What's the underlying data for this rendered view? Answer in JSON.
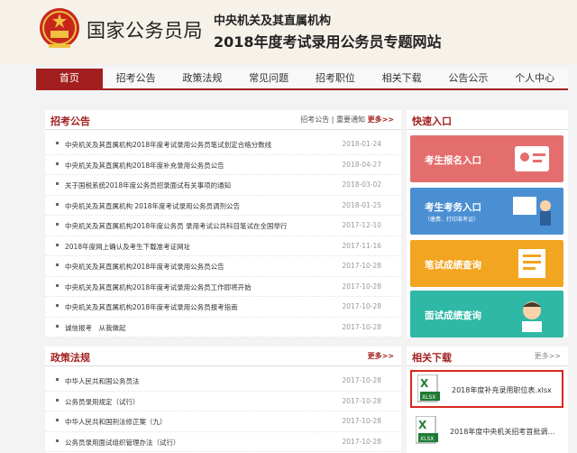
{
  "header": {
    "brand": "国家公务员局",
    "line1": "中央机关及其直属机构",
    "line2": "2018年度考试录用公务员专题网站"
  },
  "nav": [
    "首页",
    "招考公告",
    "政策法规",
    "常见问题",
    "招考职位",
    "相关下载",
    "公告公示",
    "个人中心"
  ],
  "announcements": {
    "title": "招考公告",
    "more_a": "招考公告",
    "more_sep": " | ",
    "more_b": "重要通知",
    "more_c": "更多>>",
    "items": [
      {
        "title": "中央机关及其直属机构2018年度考试录用公务员笔试划定合格分数线",
        "date": "2018-01-24"
      },
      {
        "title": "中央机关及其直属机构2018年度补充录用公务员公告",
        "date": "2018-04-27"
      },
      {
        "title": "关于国税系统2018年度公务员招录面试有关事项的通知",
        "date": "2018-03-02"
      },
      {
        "title": "中央机关及其直属机构 2018年度考试录用公务员调剂公告",
        "date": "2018-01-25"
      },
      {
        "title": "中央机关及其直属机构2018年度公务员 录用考试公共科目笔试在全国举行",
        "date": "2017-12-10"
      },
      {
        "title": "2018年度网上确认及考生下载准考证网址",
        "date": "2017-11-16"
      },
      {
        "title": "中央机关及其直属机构2018年度考试录用公务员公告",
        "date": "2017-10-28"
      },
      {
        "title": "中央机关及其直属机构2018年度考试录用公务员工作即将开始",
        "date": "2017-10-28"
      },
      {
        "title": "中央机关及其直属机构2018年度考试录用公务员报考指南",
        "date": "2017-10-28"
      },
      {
        "title": "诚信报考　从我做起",
        "date": "2017-10-28"
      }
    ]
  },
  "policies": {
    "title": "政策法规",
    "more": "更多>>",
    "items": [
      {
        "title": "中华人民共和国公务员法",
        "date": "2017-10-28"
      },
      {
        "title": "公务员录用规定（试行）",
        "date": "2017-10-28"
      },
      {
        "title": "中华人民共和国刑法修正案（九）",
        "date": "2017-10-28"
      },
      {
        "title": "公务员录用面试组织管理办法（试行）",
        "date": "2017-10-28"
      }
    ]
  },
  "quick": {
    "title": "快速入口",
    "items": [
      {
        "label": "考生报名入口",
        "sub": "",
        "color": "#e46e6e"
      },
      {
        "label": "考生考务入口",
        "sub": "（缴费、打印准考证）",
        "color": "#4b8fd3"
      },
      {
        "label": "笔试成绩查询",
        "sub": "",
        "color": "#f2a520"
      },
      {
        "label": "面试成绩查询",
        "sub": "",
        "color": "#2fb8a6"
      }
    ]
  },
  "downloads": {
    "title": "相关下载",
    "more": "更多>>",
    "items": [
      {
        "name": "2018年度补充录用职位表.xlsx",
        "icon": "XLSX"
      },
      {
        "name": "2018年度中央机关招考首批调…",
        "icon": "XLSX"
      }
    ]
  },
  "colors": {
    "accent": "#a31f1f",
    "highlight": "#d8281d"
  }
}
